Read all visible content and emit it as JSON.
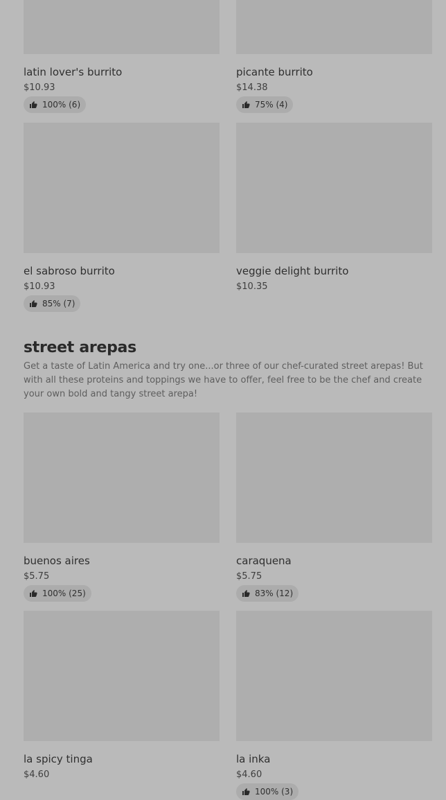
{
  "top_items": [
    {
      "name": "latin lover's burrito",
      "price": "$10.93",
      "rating": "100% (6)"
    },
    {
      "name": "picante burrito",
      "price": "$14.38",
      "rating": "75% (4)"
    },
    {
      "name": "el sabroso burrito",
      "price": "$10.93",
      "rating": "85% (7)"
    },
    {
      "name": "veggie delight burrito",
      "price": "$10.35",
      "rating": null
    }
  ],
  "section": {
    "title": "street arepas",
    "description": "Get a taste of Latin America and try one...or three of our chef-curated street arepas! But with all these proteins and toppings we have to offer, feel free to be the chef and create your own bold and tangy street arepa!"
  },
  "arepas": [
    {
      "name": "buenos aires",
      "price": "$5.75",
      "rating": "100% (25)"
    },
    {
      "name": "caraquena",
      "price": "$5.75",
      "rating": "83% (12)"
    },
    {
      "name": "la spicy tinga",
      "price": "$4.60",
      "rating": null
    },
    {
      "name": "la inka",
      "price": "$4.60",
      "rating": "100% (3)"
    }
  ],
  "icons": {
    "rating": "thumbs-up-icon"
  },
  "colors": {
    "background": "#bababa",
    "image_placeholder": "#aeaeae",
    "badge": "#acacac"
  }
}
